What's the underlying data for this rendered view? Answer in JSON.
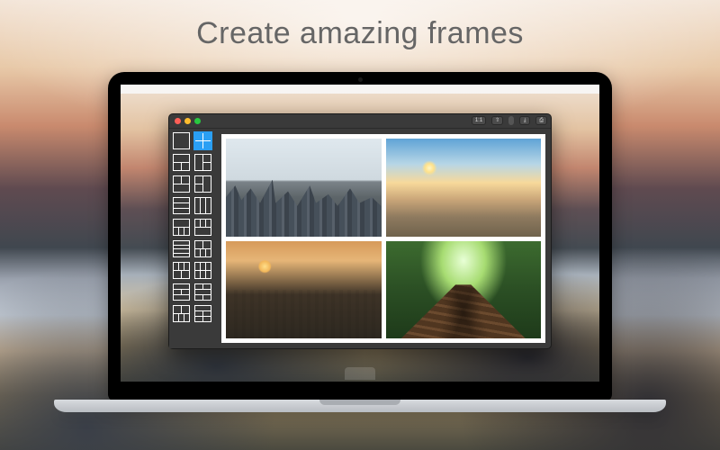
{
  "headline": "Create amazing frames",
  "toolbar": {
    "ratio": "1:1",
    "icons": {
      "share": "share-icon",
      "save": "save-icon",
      "print": "print-icon"
    }
  },
  "layouts": [
    {
      "id": "single",
      "cols": [
        1
      ],
      "rows": 1,
      "selected": false
    },
    {
      "id": "2x2",
      "cols": [
        1,
        1
      ],
      "rows": 2,
      "selected": true
    },
    {
      "id": "t1b2",
      "cols": [
        [
          1
        ],
        [
          1,
          1
        ]
      ],
      "selected": false
    },
    {
      "id": "l1r2",
      "cols": "l1r2",
      "selected": false
    },
    {
      "id": "t2b1",
      "cols": [
        [
          1,
          1
        ],
        [
          1
        ]
      ],
      "selected": false
    },
    {
      "id": "l2r1",
      "cols": "l2r1",
      "selected": false
    },
    {
      "id": "3h",
      "cols": [
        [
          1
        ],
        [
          1
        ],
        [
          1
        ]
      ],
      "selected": false
    },
    {
      "id": "3v",
      "cols": [
        [
          1,
          1,
          1
        ]
      ],
      "selected": false
    },
    {
      "id": "1-3",
      "cols": [
        [
          1
        ],
        [
          1,
          1,
          1
        ]
      ],
      "selected": false
    },
    {
      "id": "3-1",
      "cols": [
        [
          1,
          1,
          1
        ],
        [
          1
        ]
      ],
      "selected": false
    },
    {
      "id": "4h",
      "cols": [
        [
          1
        ],
        [
          1
        ],
        [
          1
        ],
        [
          1
        ]
      ],
      "selected": false
    },
    {
      "id": "2-3",
      "cols": [
        [
          1,
          1
        ],
        [
          1,
          1,
          1
        ]
      ],
      "selected": false
    },
    {
      "id": "3-2",
      "cols": [
        [
          1,
          1,
          1
        ],
        [
          1,
          1
        ]
      ],
      "selected": false
    },
    {
      "id": "grid6a",
      "cols": [
        [
          1,
          1,
          1
        ],
        [
          1,
          1,
          1
        ]
      ],
      "selected": false
    },
    {
      "id": "1-2-1",
      "cols": [
        [
          1
        ],
        [
          1,
          1
        ],
        [
          1
        ]
      ],
      "selected": false
    },
    {
      "id": "2-1-2",
      "cols": [
        [
          1,
          1
        ],
        [
          1
        ],
        [
          1,
          1
        ]
      ],
      "selected": false
    },
    {
      "id": "5a",
      "cols": [
        [
          1,
          1
        ],
        [
          1,
          1,
          1
        ]
      ],
      "selected": false
    },
    {
      "id": "5b",
      "cols": [
        [
          1
        ],
        [
          1,
          1
        ],
        [
          1,
          1
        ]
      ],
      "selected": false
    }
  ],
  "collage": {
    "cells": [
      "city-skyline",
      "beach-sunset",
      "field-sunset",
      "forest-path"
    ]
  }
}
